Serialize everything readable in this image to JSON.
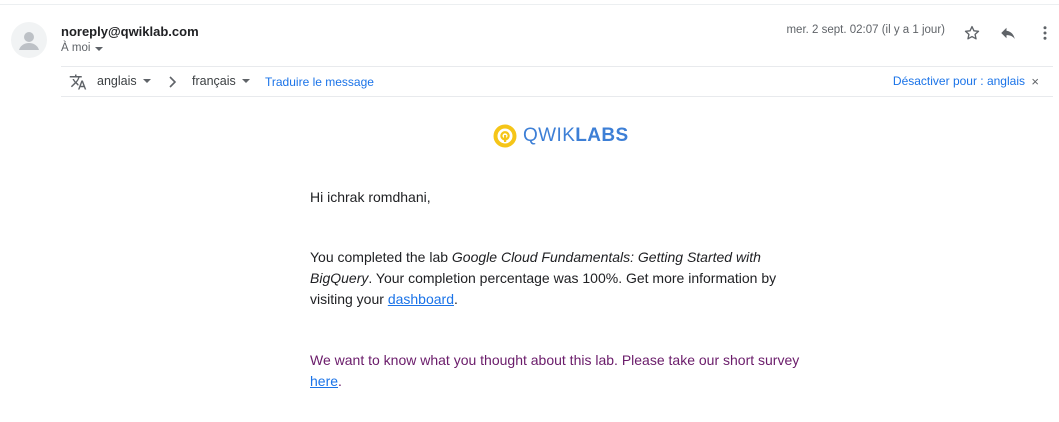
{
  "header": {
    "sender": "noreply@qwiklab.com",
    "recipient": "À moi",
    "date": "mer. 2 sept. 02:07 (il y a 1 jour)",
    "icons": [
      "star-icon",
      "reply-icon",
      "more-vert-icon"
    ]
  },
  "translation": {
    "source_lang": "anglais",
    "target_lang": "français",
    "translate_label": "Traduire le message",
    "disable_label": "Désactiver pour : anglais",
    "close_symbol": "×"
  },
  "logo": {
    "prefix": "QWIK",
    "suffix": "LABS",
    "ring_color": "#f5c518"
  },
  "message": {
    "greeting": "Hi ichrak romdhani,",
    "completed_prefix": "You completed the lab ",
    "lab_name": "Google Cloud Fundamentals: Getting Started with BigQuery",
    "completed_middle": ". Your completion percentage was 100%. Get more information by visiting your ",
    "dashboard_link": "dashboard",
    "completed_end": ".",
    "survey_text": "We want to know what you thought about this lab. Please take our short survey ",
    "survey_link": "here",
    "survey_end": "."
  },
  "colors": {
    "link": "#1a73e8",
    "survey_text": "#6a1b6a",
    "brand_blue": "#3d7fd6"
  }
}
